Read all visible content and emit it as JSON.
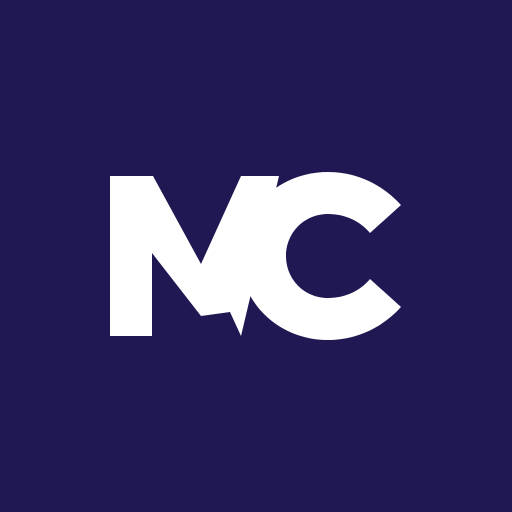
{
  "logo": {
    "text": "MC",
    "background_color": "#1f1853",
    "foreground_color": "#ffffff"
  }
}
